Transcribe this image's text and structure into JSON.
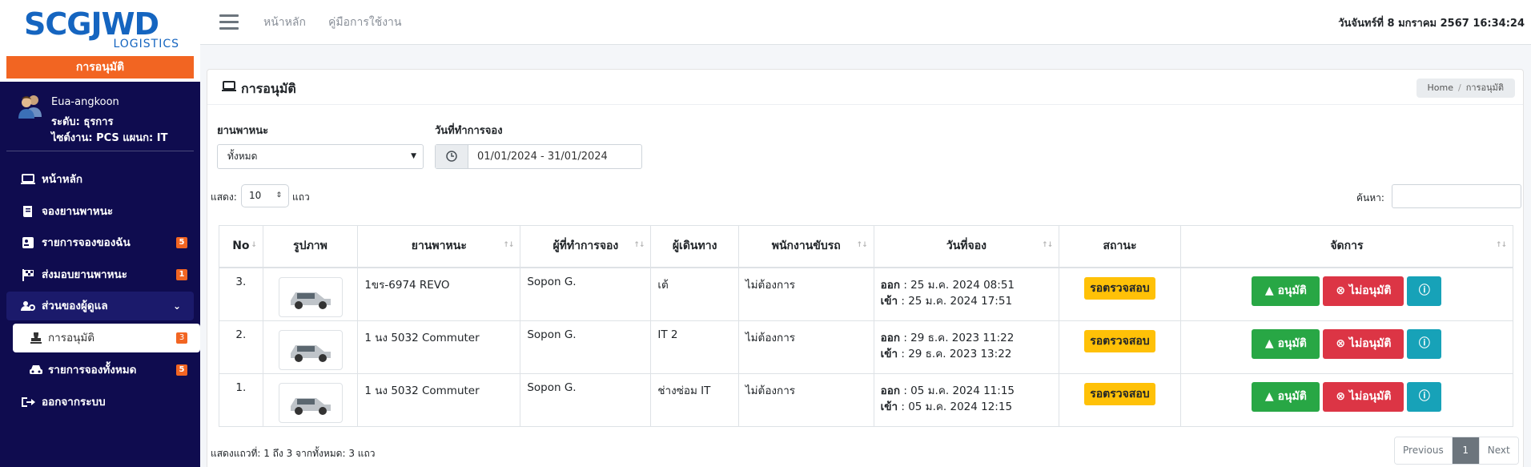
{
  "brand": {
    "logo_text": "SCGJWD",
    "logo_sub": "LOGISTICS",
    "module": "การอนุมัติ"
  },
  "user": {
    "name": "Eua-angkoon",
    "level": "ระดับ: ธุรการ",
    "site": "ไซต์งาน: PCS แผนก: IT"
  },
  "sidebar": {
    "items": [
      {
        "label": "หน้าหลัก",
        "icon": "laptop-icon"
      },
      {
        "label": "จองยานพาหนะ",
        "icon": "book-icon"
      },
      {
        "label": "รายการจองของฉัน",
        "icon": "id-card-icon",
        "badge": "5"
      },
      {
        "label": "ส่งมอบยานพาหนะ",
        "icon": "flag-icon",
        "badge": "1"
      },
      {
        "label": "ส่วนของผู้ดูแล",
        "icon": "users-cog-icon"
      },
      {
        "label": "การอนุมัติ",
        "icon": "stamp-icon",
        "badge": "3"
      },
      {
        "label": "รายการจองทั้งหมด",
        "icon": "car-icon",
        "badge": "5"
      },
      {
        "label": "ออกจากระบบ",
        "icon": "sign-out-icon"
      }
    ]
  },
  "topbar": {
    "home": "หน้าหลัก",
    "manual": "คู่มือการใช้งาน",
    "datetime": "วันจันทร์ที่ 8 มกราคม 2567  16:34:24"
  },
  "card": {
    "title": "การอนุมัติ",
    "breadcrumb_home": "Home",
    "breadcrumb_sep": "/",
    "breadcrumb_current": "การอนุมัติ"
  },
  "filters": {
    "vehicle_label": "ยานพาหนะ",
    "vehicle_value": "ทั้งหมด",
    "date_label": "วันที่ทำการจอง",
    "date_value": "01/01/2024 - 31/01/2024"
  },
  "table_controls": {
    "show_label": "แสดง:",
    "show_value": "10",
    "show_suffix": "แถว",
    "search_label": "ค้นหา:"
  },
  "table": {
    "headers": [
      "No",
      "รูปภาพ",
      "ยานพาหนะ",
      "ผู้ที่ทำการจอง",
      "ผู้เดินทาง",
      "พนักงานขับรถ",
      "วันที่จอง",
      "สถานะ",
      "จัดการ"
    ],
    "rows": [
      {
        "no": "3.",
        "vehicle": "1ขร-6974 REVO",
        "booker": "Sopon G.",
        "traveler": "เต้",
        "driver": "ไม่ต้องการ",
        "out_label": "ออก",
        "out": ": 25 ม.ค. 2024 08:51",
        "in_label": "เข้า",
        "in": " : 25 ม.ค. 2024 17:51",
        "status": "รอตรวจสอบ"
      },
      {
        "no": "2.",
        "vehicle": "1 นง 5032 Commuter",
        "booker": "Sopon G.",
        "traveler": "IT 2",
        "driver": "ไม่ต้องการ",
        "out_label": "ออก",
        "out": ": 29 ธ.ค. 2023 11:22",
        "in_label": "เข้า",
        "in": " : 29 ธ.ค. 2023 13:22",
        "status": "รอตรวจสอบ"
      },
      {
        "no": "1.",
        "vehicle": "1 นง 5032 Commuter",
        "booker": "Sopon G.",
        "traveler": "ช่างซ่อม IT",
        "driver": "ไม่ต้องการ",
        "out_label": "ออก",
        "out": ": 05 ม.ค. 2024 11:15",
        "in_label": "เข้า",
        "in": " : 05 ม.ค. 2024 12:15",
        "status": "รอตรวจสอบ"
      }
    ],
    "approve_label": "อนุมัติ",
    "reject_label": "ไม่อนุมัติ"
  },
  "footer": {
    "info": "แสดงแถวที่: 1 ถึง 3 จากทั้งหมด: 3 แถว",
    "previous": "Previous",
    "page": "1",
    "next": "Next"
  },
  "colors": {
    "sidebar": "#0f0c4f",
    "accent": "#f26522",
    "approve": "#28a745",
    "reject": "#dc3545",
    "info": "#17a2b8",
    "status": "#ffc107"
  }
}
